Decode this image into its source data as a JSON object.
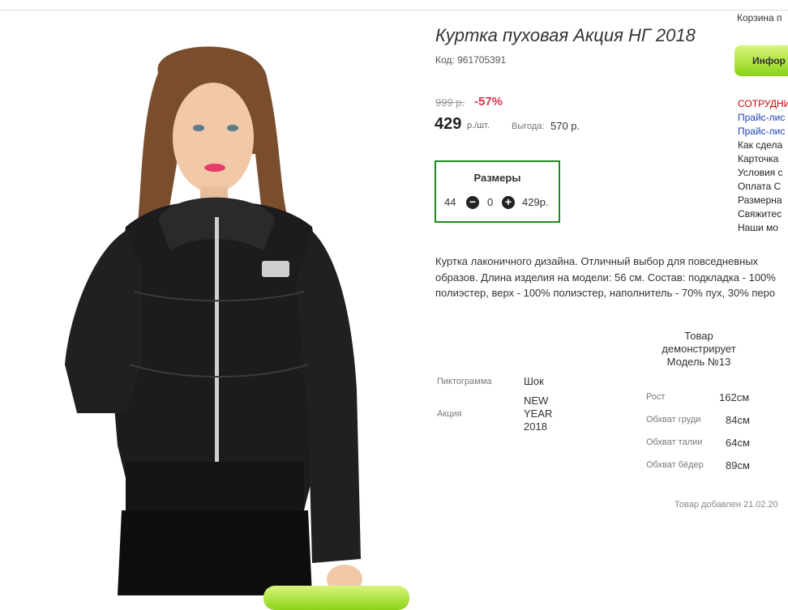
{
  "header": {
    "cart_label": "Корзина п",
    "info_button": "Инфор"
  },
  "sidebar": {
    "items": [
      {
        "label": "СОТРУДНИ",
        "style": "red"
      },
      {
        "label": "Прайс-лис",
        "style": "blue"
      },
      {
        "label": "Прайс-лис",
        "style": "blue"
      },
      {
        "label": "Как сдела",
        "style": "dark"
      },
      {
        "label": "Карточка",
        "style": "dark"
      },
      {
        "label": "Условия с",
        "style": "dark"
      },
      {
        "label": "Оплата С",
        "style": "dark"
      },
      {
        "label": "Размерна",
        "style": "dark"
      },
      {
        "label": "Свяжитес",
        "style": "dark"
      },
      {
        "label": "Наши мо",
        "style": "dark"
      }
    ]
  },
  "product": {
    "title": "Куртка пуховая Акция НГ 2018",
    "code": "Код: 961705391",
    "old_price": "999 р.",
    "discount": "-57%",
    "price": "429",
    "price_unit": "р./шт.",
    "profit_label": "Выгода:",
    "profit_value": "570 р.",
    "description": "Куртка лаконичного дизайна. Отличный выбор для повседневных образов. Длина изделия на модели: 56 см. Состав: подкладка - 100% полиэстер, верх - 100% полиэстер, наполнитель - 70% пух, 30% перо",
    "added": "Товар добавлен 21.02.20"
  },
  "sizes": {
    "title": "Размеры",
    "size": "44",
    "minus_icon": "minus-circle-icon",
    "quantity": "0",
    "plus_icon": "plus-circle-icon",
    "price": "429р."
  },
  "attributes": [
    {
      "label": "Пиктограмма",
      "value": "Шок"
    },
    {
      "label": "Акция",
      "value": "NEW YEAR 2018"
    }
  ],
  "model": {
    "heading": "Товар демонстрирует Модель №13",
    "measurements": [
      {
        "label": "Рост",
        "value": "162см"
      },
      {
        "label": "Обхват груди",
        "value": "84см"
      },
      {
        "label": "Обхват талии",
        "value": "64см"
      },
      {
        "label": "Обхват бёдер",
        "value": "89см"
      }
    ]
  },
  "colors": {
    "accent_green": "#8bd317",
    "discount_red": "#e0334d",
    "box_border": "#1e8a1e"
  }
}
